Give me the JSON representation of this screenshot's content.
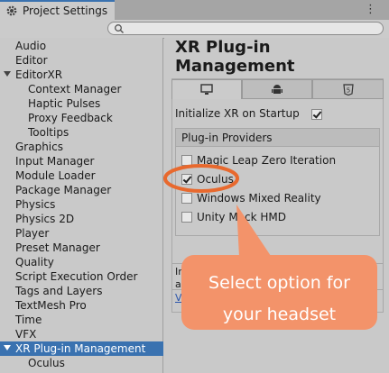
{
  "window": {
    "tab_title": "Project Settings",
    "menu_glyph": "⋮"
  },
  "search": {
    "placeholder": ""
  },
  "sidebar": {
    "items": [
      {
        "label": "Audio"
      },
      {
        "label": "Editor"
      },
      {
        "label": "EditorXR"
      },
      {
        "label": "Context Manager"
      },
      {
        "label": "Haptic Pulses"
      },
      {
        "label": "Proxy Feedback"
      },
      {
        "label": "Tooltips"
      },
      {
        "label": "Graphics"
      },
      {
        "label": "Input Manager"
      },
      {
        "label": "Module Loader"
      },
      {
        "label": "Package Manager"
      },
      {
        "label": "Physics"
      },
      {
        "label": "Physics 2D"
      },
      {
        "label": "Player"
      },
      {
        "label": "Preset Manager"
      },
      {
        "label": "Quality"
      },
      {
        "label": "Script Execution Order"
      },
      {
        "label": "Tags and Layers"
      },
      {
        "label": "TextMesh Pro"
      },
      {
        "label": "Time"
      },
      {
        "label": "VFX"
      },
      {
        "label": "XR Plug-in Management"
      },
      {
        "label": "Oculus"
      }
    ],
    "selected": "XR Plug-in Management"
  },
  "main": {
    "heading": "XR Plug-in Management",
    "tabs": [
      "desktop-icon",
      "android-icon",
      "html5-icon"
    ],
    "init_label": "Initialize XR on Startup",
    "init_checked": true,
    "providers_header": "Plug-in Providers",
    "providers": [
      {
        "label": "Magic Leap Zero Iteration",
        "checked": false
      },
      {
        "label": "Oculus",
        "checked": true
      },
      {
        "label": "Windows Mixed Reality",
        "checked": false
      },
      {
        "label": "Unity Mock HMD",
        "checked": false
      }
    ],
    "help_lines": [
      "Ir",
      "a",
      "V"
    ]
  },
  "annotation": {
    "line1": "Select option for",
    "line2": "your headset",
    "color": "#f3936a"
  }
}
